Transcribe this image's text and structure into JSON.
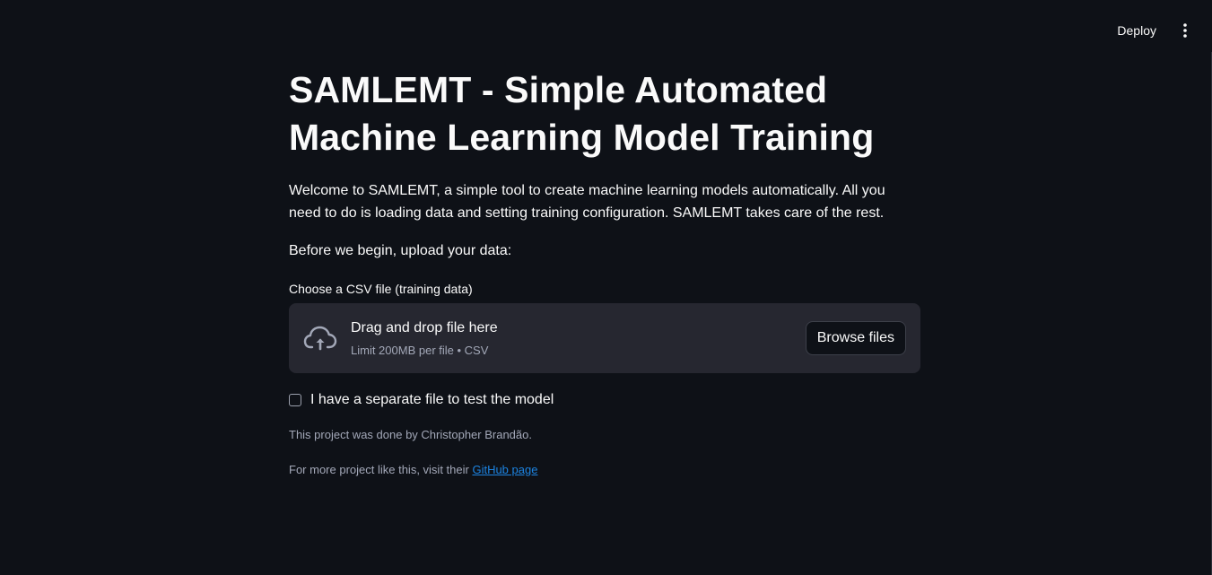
{
  "header": {
    "deploy_label": "Deploy",
    "menu_icon": "vertical-ellipsis-icon"
  },
  "main": {
    "title": "SAMLEMT - Simple Automated Machine Learning Model Training",
    "intro": "Welcome to SAMLEMT, a simple tool to create machine learning models automatically. All you need to do is loading data and setting training configuration. SAMLEMT takes care of the rest.",
    "begin": "Before we begin, upload your data:",
    "uploader": {
      "label": "Choose a CSV file (training data)",
      "drag_text": "Drag and drop file here",
      "limit_text": "Limit 200MB per file • CSV",
      "browse_label": "Browse files",
      "icon": "cloud-upload-icon"
    },
    "test_checkbox": {
      "label": "I have a separate file to test the model",
      "checked": false
    },
    "credit": "This project was done by Christopher Brandão.",
    "more_prefix": "For more project like this, visit their ",
    "github_link": "GitHub page"
  },
  "colors": {
    "background": "#0e1117",
    "panel": "#262730",
    "text": "#fafafa",
    "muted": "#a3a8b8",
    "link": "#1c83e1"
  }
}
